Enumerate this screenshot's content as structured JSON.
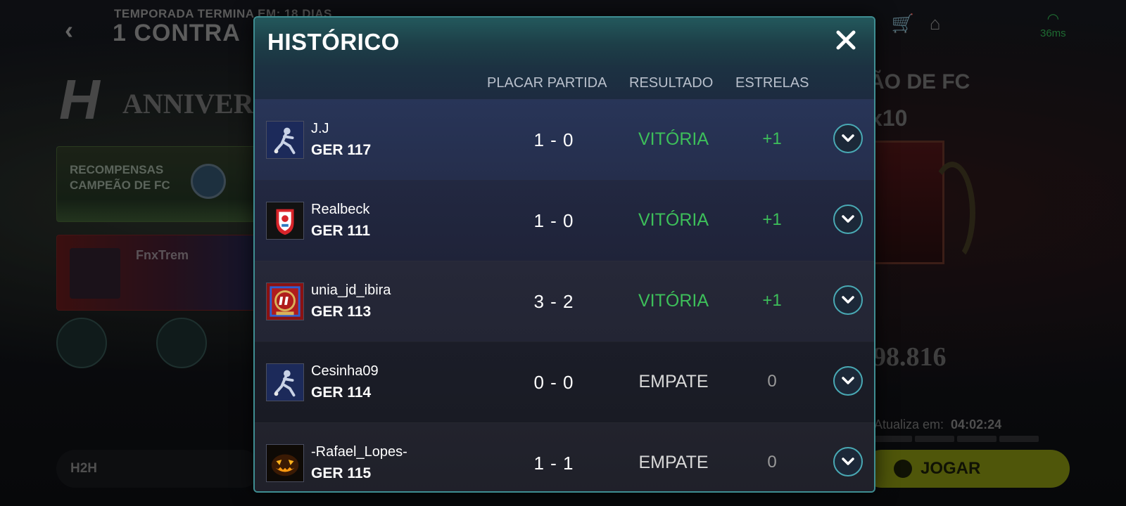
{
  "background": {
    "back_glyph": "‹",
    "season_text": "TEMPORADA TERMINA EM: 18 DIAS",
    "contracts_text": "1 CONTRA",
    "anniversary_text": "ANNIVERS",
    "anniversary_logo": "H",
    "rewards_line1": "RECOMPENSAS",
    "rewards_line2": "CAMPEÃO DE FC",
    "player_name": "FnxTrem",
    "h2h_label": "H2H",
    "right_title": "ÃO DE FC",
    "multiplier": "x10",
    "points": "98.816",
    "update_label": "Atualiza em:",
    "update_time": "04:02:24",
    "play_label": "JOGAR",
    "ping": "36ms"
  },
  "modal": {
    "title": "HISTÓRICO",
    "columns": {
      "score": "PLACAR PARTIDA",
      "result": "RESULTADO",
      "stars": "ESTRELAS"
    },
    "matches": [
      {
        "opponent": "J.J",
        "rating": "GER 117",
        "score": "1 - 0",
        "result": "VITÓRIA",
        "stars": "+1",
        "crest": "player-card-icon",
        "result_color": "#3dbf5a"
      },
      {
        "opponent": "Realbeck",
        "rating": "GER 111",
        "score": "1 - 0",
        "result": "VITÓRIA",
        "stars": "+1",
        "crest": "southampton-crest-icon",
        "result_color": "#3dbf5a"
      },
      {
        "opponent": "unia_jd_ibira",
        "rating": "GER 113",
        "score": "3 - 2",
        "result": "VITÓRIA",
        "stars": "+1",
        "crest": "anniversary-crest-icon",
        "result_color": "#3dbf5a"
      },
      {
        "opponent": "Cesinha09",
        "rating": "GER 114",
        "score": "0 - 0",
        "result": "EMPATE",
        "stars": "0",
        "crest": "player-card-icon",
        "result_color": "#d8d8d8"
      },
      {
        "opponent": "-Rafael_Lopes-",
        "rating": "GER 115",
        "score": "1 - 1",
        "result": "EMPATE",
        "stars": "0",
        "crest": "pumpkin-crest-icon",
        "result_color": "#d8d8d8"
      }
    ]
  },
  "colors": {
    "win": "#3dbf5a",
    "draw_result": "#d8d8d8",
    "draw_stars": "#9a9a9a",
    "accent": "#49a9b4"
  }
}
